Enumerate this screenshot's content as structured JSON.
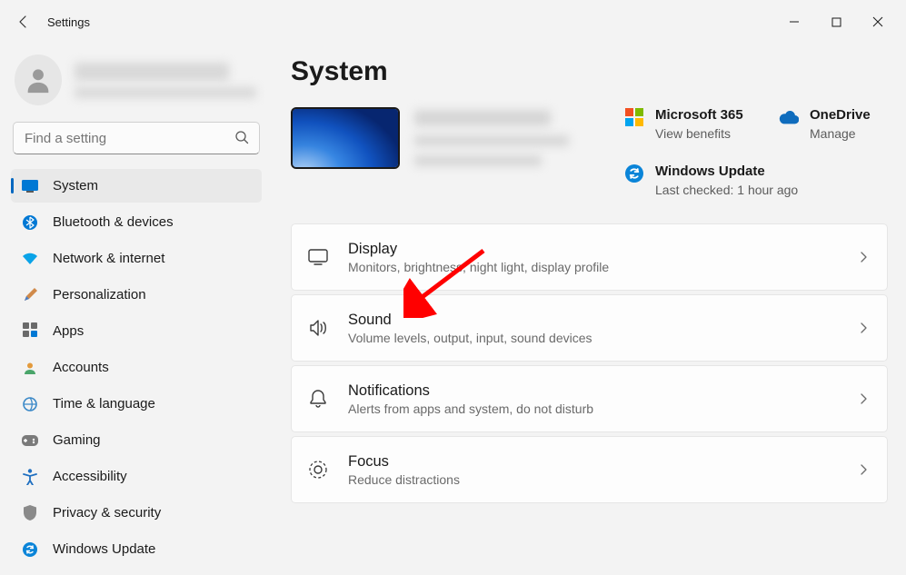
{
  "titlebar": {
    "title": "Settings"
  },
  "search": {
    "placeholder": "Find a setting"
  },
  "nav": {
    "items": [
      {
        "label": "System"
      },
      {
        "label": "Bluetooth & devices"
      },
      {
        "label": "Network & internet"
      },
      {
        "label": "Personalization"
      },
      {
        "label": "Apps"
      },
      {
        "label": "Accounts"
      },
      {
        "label": "Time & language"
      },
      {
        "label": "Gaming"
      },
      {
        "label": "Accessibility"
      },
      {
        "label": "Privacy & security"
      },
      {
        "label": "Windows Update"
      }
    ]
  },
  "page": {
    "title": "System"
  },
  "promos": {
    "ms365": {
      "title": "Microsoft 365",
      "sub": "View benefits"
    },
    "onedrive": {
      "title": "OneDrive",
      "sub": "Manage"
    },
    "update": {
      "title": "Windows Update",
      "sub": "Last checked: 1 hour ago"
    }
  },
  "cards": [
    {
      "title": "Display",
      "sub": "Monitors, brightness, night light, display profile"
    },
    {
      "title": "Sound",
      "sub": "Volume levels, output, input, sound devices"
    },
    {
      "title": "Notifications",
      "sub": "Alerts from apps and system, do not disturb"
    },
    {
      "title": "Focus",
      "sub": "Reduce distractions"
    }
  ]
}
